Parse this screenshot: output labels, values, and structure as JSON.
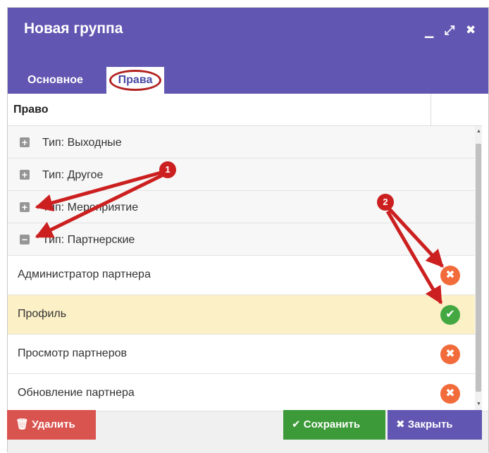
{
  "dialog": {
    "title": "Новая группа",
    "controls": {
      "minimize": "▁",
      "maximize": "⤢",
      "close": "✖"
    }
  },
  "tabs": [
    {
      "label": "Основное",
      "active": false
    },
    {
      "label": "Права",
      "active": true
    }
  ],
  "table": {
    "column_header": "Право",
    "groups": [
      {
        "label": "Тип: Выходные",
        "expander": "+"
      },
      {
        "label": "Тип: Другое",
        "expander": "+"
      },
      {
        "label": "Тип: Мероприятие",
        "expander": "+"
      },
      {
        "label": "Тип: Партнерские",
        "expander": "−"
      }
    ],
    "permissions": [
      {
        "label": "Администратор партнера",
        "status": "deny",
        "glyph": "✖"
      },
      {
        "label": "Профиль",
        "status": "allow",
        "glyph": "✔",
        "selected": true
      },
      {
        "label": "Просмотр партнеров",
        "status": "deny",
        "glyph": "✖"
      },
      {
        "label": "Обновление партнера",
        "status": "deny",
        "glyph": "✖"
      }
    ]
  },
  "footer": {
    "delete_label": "🗑 Удалить",
    "save_label": "✔ Сохранить",
    "close_label": "✖  Закрыть"
  },
  "annotations": {
    "callout_1": "1",
    "callout_2": "2"
  },
  "colors": {
    "header": "#6157b2",
    "selected_row": "#fcf0c6",
    "deny": "#f26b3a",
    "allow": "#44a842",
    "delete_button": "#d9534f",
    "save_button": "#3c9a39",
    "close_button": "#6157b2",
    "annotation": "#cc1f1f"
  }
}
